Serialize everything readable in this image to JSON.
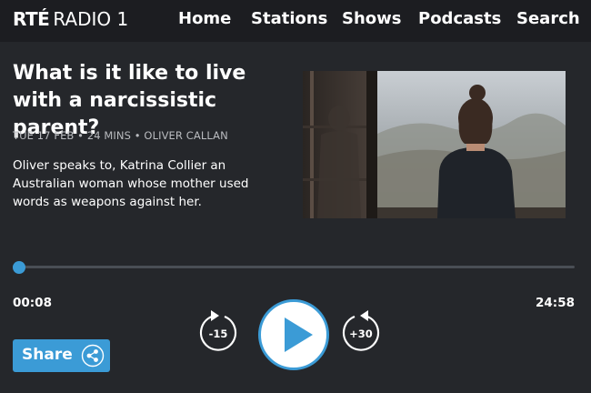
{
  "header": {
    "logo_rte": "RTÉ",
    "logo_radio": "RADIO 1",
    "nav": [
      "Home",
      "Stations",
      "Shows",
      "Podcasts",
      "Search"
    ]
  },
  "episode": {
    "title": "What is it like to live with a narcissistic parent?",
    "meta": "TUE 17 FEB • 24 MINS • OLIVER CALLAN",
    "description": "Oliver speaks to, Katrina Collier an Australian woman whose mother used words as weapons against her."
  },
  "player": {
    "current_time": "00:08",
    "duration": "24:58",
    "progress_fraction": 0.0053,
    "skip_back_label": "-15",
    "skip_forward_label": "+30",
    "accent_color": "#3b9bd6"
  },
  "share": {
    "label": "Share",
    "icon": "share-icon"
  }
}
